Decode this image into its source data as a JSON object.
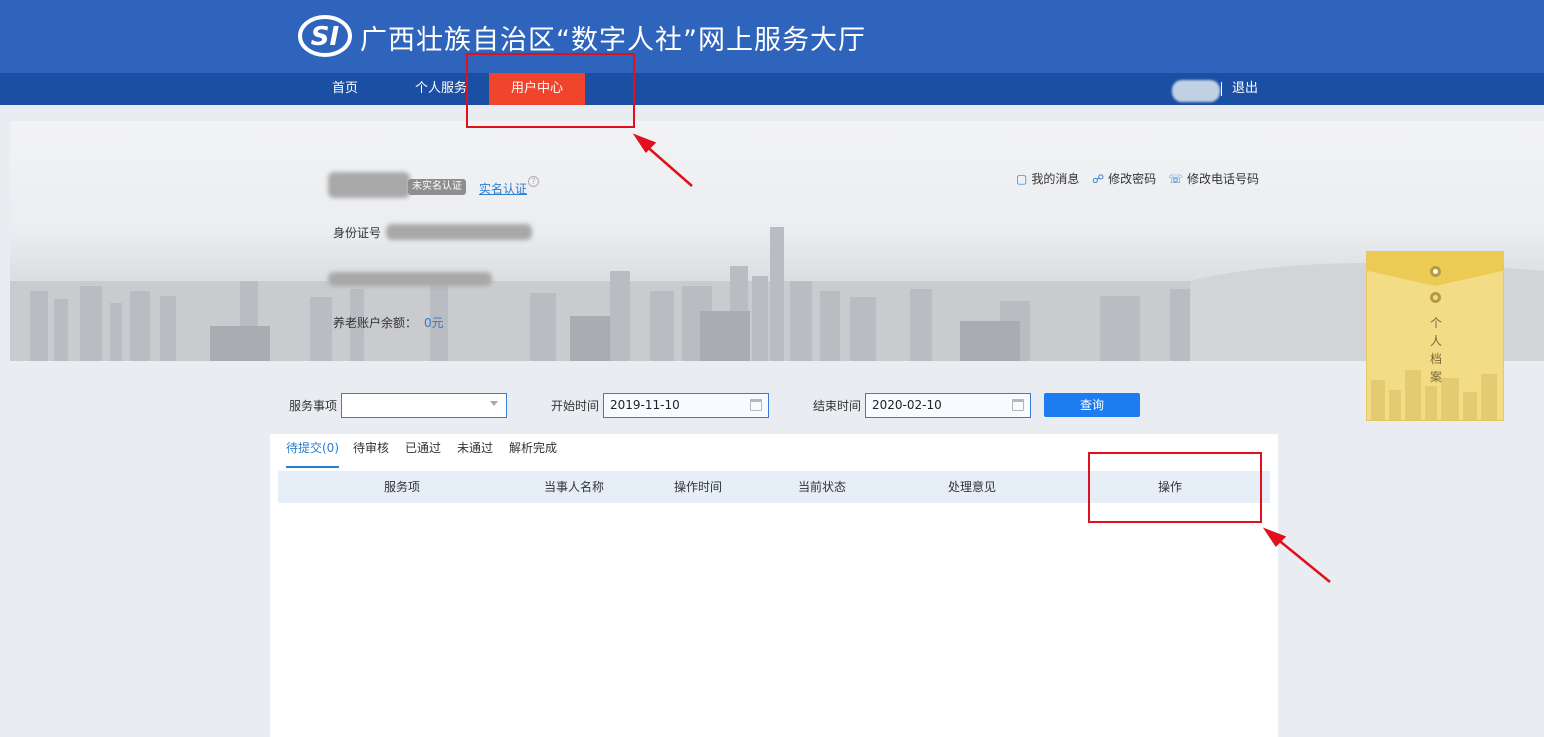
{
  "header": {
    "logo_text": "SI",
    "title": "广西壮族自治区“数字人社”网上服务大厅"
  },
  "nav": {
    "items": [
      {
        "label": "首页"
      },
      {
        "label": "个人服务"
      },
      {
        "label": "用户中心"
      }
    ],
    "logout": "退出"
  },
  "profile": {
    "badge": "未实名认证",
    "verify_link": "实名认证",
    "help": "?",
    "id_label": "身份证号",
    "balance_label": "养老账户余额：",
    "balance_value": "0元",
    "links": [
      {
        "icon": "message-icon",
        "label": "我的消息"
      },
      {
        "icon": "shield-check-icon",
        "label": "修改密码"
      },
      {
        "icon": "phone-icon",
        "label": "修改电话号码"
      }
    ]
  },
  "side_panel": {
    "label": "个人档案"
  },
  "search": {
    "service_label": "服务事项",
    "service_value": "",
    "start_label": "开始时间",
    "start_value": "2019-11-10",
    "end_label": "结束时间",
    "end_value": "2020-02-10",
    "query_button": "查询"
  },
  "tabs": [
    {
      "label": "待提交(0)"
    },
    {
      "label": "待审核"
    },
    {
      "label": "已通过"
    },
    {
      "label": "未通过"
    },
    {
      "label": "解析完成"
    }
  ],
  "table": {
    "columns": [
      "服务项",
      "当事人名称",
      "操作时间",
      "当前状态",
      "处理意见",
      "操作"
    ],
    "rows": []
  },
  "colors": {
    "header_bg": "#2f64bc",
    "nav_bg": "#1a4fa3",
    "active_nav": "#f0452c",
    "accent_blue": "#1d7df0",
    "annotation_red": "#e0101c"
  }
}
